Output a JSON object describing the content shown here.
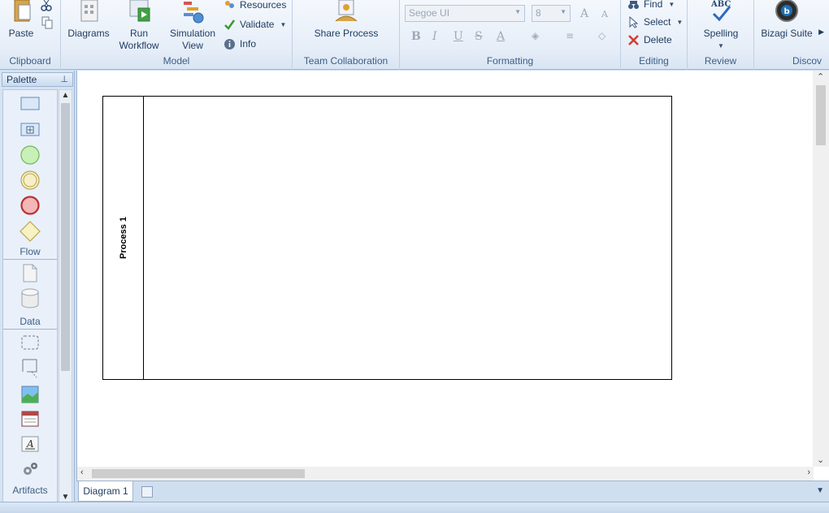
{
  "ribbon": {
    "clipboard": {
      "label": "Clipboard",
      "paste": "Paste"
    },
    "model": {
      "label": "Model",
      "diagrams": "Diagrams",
      "run_workflow_1": "Run",
      "run_workflow_2": "Workflow",
      "simulation_1": "Simulation",
      "simulation_2": "View",
      "resources": "Resources",
      "validate": "Validate",
      "info": "Info"
    },
    "team": {
      "label": "Team Collaboration",
      "share": "Share Process"
    },
    "formatting": {
      "label": "Formatting",
      "font_name": "Segoe UI",
      "font_size": "8"
    },
    "editing": {
      "label": "Editing",
      "find": "Find",
      "select": "Select",
      "delete": "Delete"
    },
    "review": {
      "label": "Review",
      "spelling": "Spelling",
      "abc": "ABC"
    },
    "discover": {
      "label": "Discov",
      "bizagi": "Bizagi Suite"
    }
  },
  "palette": {
    "title": "Palette",
    "sections": {
      "flow": "Flow",
      "data": "Data",
      "artifacts": "Artifacts"
    }
  },
  "canvas": {
    "pool_title": "Process 1"
  },
  "tabs": {
    "diagram1": "Diagram 1"
  },
  "colors": {
    "ribbon_bg": "#e6eef8",
    "accent": "#1e3a5f",
    "start_event": "#8fd67c",
    "end_event": "#d94c4c",
    "gateway": "#f4edb0"
  }
}
